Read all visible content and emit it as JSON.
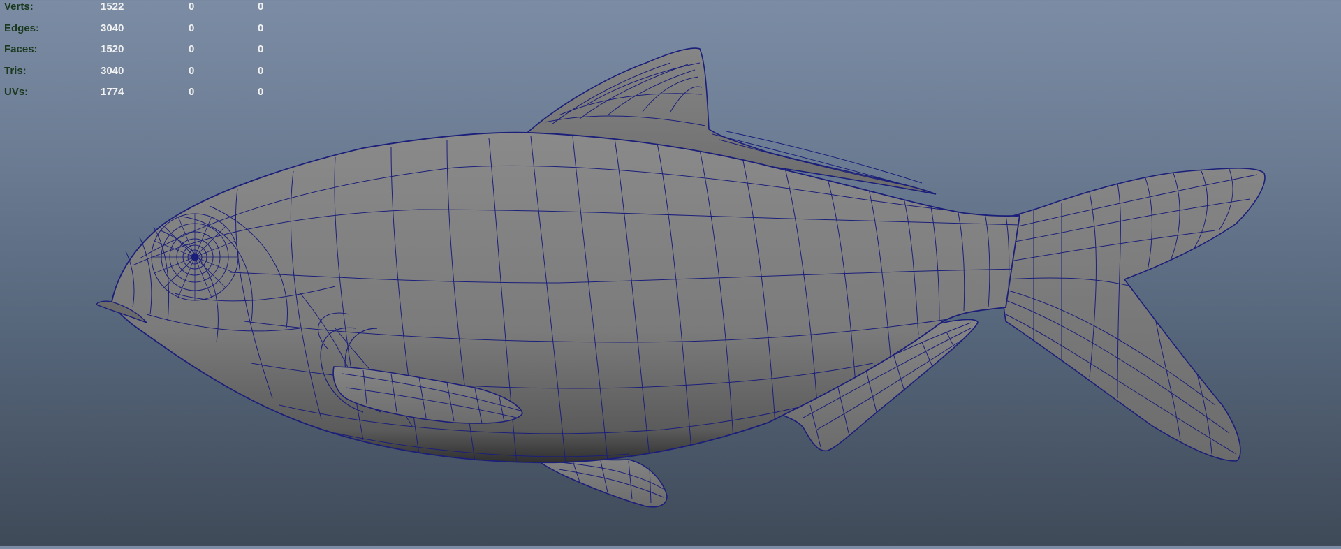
{
  "heads_up_display": {
    "poly_count": [
      {
        "label": "Verts:",
        "values": [
          "1522",
          "0",
          "0"
        ]
      },
      {
        "label": "Edges:",
        "values": [
          "3040",
          "0",
          "0"
        ]
      },
      {
        "label": "Faces:",
        "values": [
          "1520",
          "0",
          "0"
        ]
      },
      {
        "label": "Tris:",
        "values": [
          "3040",
          "0",
          "0"
        ]
      },
      {
        "label": "UVs:",
        "values": [
          "1774",
          "0",
          "0"
        ]
      }
    ]
  },
  "viewport": {
    "model": "fish-mesh",
    "display_mode": "smooth-shade-wireframe-on-shaded",
    "colors": {
      "background_top": "#7b8ca4",
      "background_bottom": "#3f4a58",
      "mesh_fill": "#7d7d7d",
      "wireframe": "#1b1f7a",
      "hud_label": "#19381d",
      "hud_value": "#f2f2f2"
    }
  }
}
